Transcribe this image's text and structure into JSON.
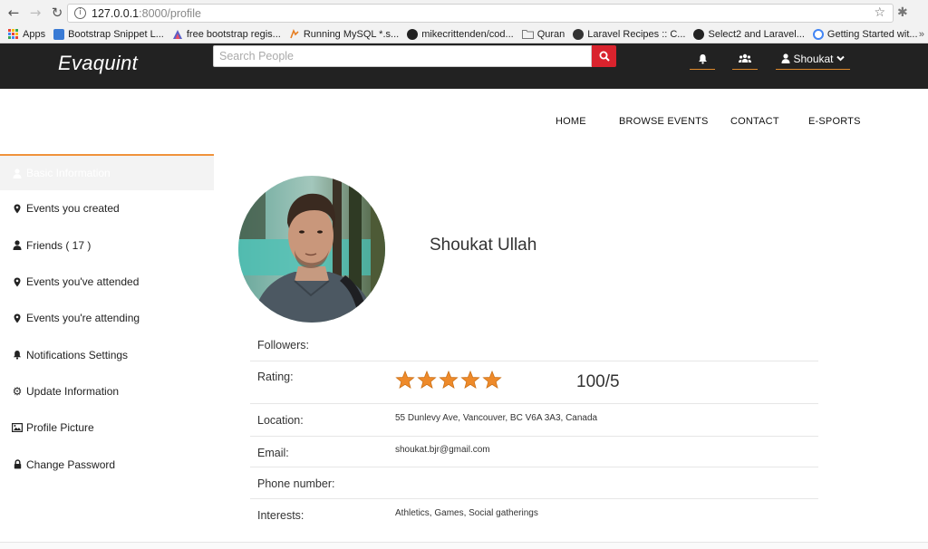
{
  "browser": {
    "url_host": "127.0.0.1",
    "url_path": ":8000/profile",
    "bookmarks": [
      {
        "label": "Apps",
        "icon": "apps-grid-icon",
        "color": ""
      },
      {
        "label": "Bootstrap Snippet L...",
        "icon": "bootstrap-snippet-icon",
        "color": "#3a7bd5"
      },
      {
        "label": "free bootstrap regis...",
        "icon": "triangle-logo-icon",
        "color": "#5b5fc7"
      },
      {
        "label": "Running MySQL *.s...",
        "icon": "mysql-icon",
        "color": "#e67e22"
      },
      {
        "label": "mikecrittenden/cod...",
        "icon": "github-icon",
        "color": "#222222"
      },
      {
        "label": "Quran",
        "icon": "folder-icon",
        "color": "#777777"
      },
      {
        "label": "Laravel Recipes :: C...",
        "icon": "laravel-recipes-icon",
        "color": "#333333"
      },
      {
        "label": "Select2 and Laravel...",
        "icon": "github-icon",
        "color": "#222222"
      },
      {
        "label": "Getting Started wit...",
        "icon": "chrome-icon",
        "color": "#4285f4"
      }
    ]
  },
  "header": {
    "brand": "Evaquint",
    "search_placeholder": "Search People",
    "user_name": "Shoukat",
    "accent_color": "#e08a2c",
    "search_button_color": "#d9232d"
  },
  "nav": {
    "items": [
      "HOME",
      "BROWSE EVENTS",
      "CONTACT",
      "E-SPORTS"
    ]
  },
  "sidebar": {
    "items": [
      {
        "label": "Basic Information",
        "icon": "user-icon",
        "active": true
      },
      {
        "label": "Events you created",
        "icon": "map-marker-icon"
      },
      {
        "label": "Friends ( 17 )",
        "icon": "user-icon"
      },
      {
        "label": "Events you've attended",
        "icon": "map-marker-icon"
      },
      {
        "label": "Events you're attending",
        "icon": "map-marker-icon"
      },
      {
        "label": "Notifications Settings",
        "icon": "bell-icon"
      },
      {
        "label": "Update Information",
        "icon": "gear-icon"
      },
      {
        "label": "Profile Picture",
        "icon": "picture-icon"
      },
      {
        "label": "Change Password",
        "icon": "lock-icon"
      }
    ]
  },
  "profile": {
    "name": "Shoukat Ullah",
    "followers_label": "Followers:",
    "followers_value": "",
    "rating_label": "Rating:",
    "rating_stars": 5,
    "rating_max_stars": 5,
    "rating_text": "100/5",
    "location_label": "Location:",
    "location_value": "55 Dunlevy Ave, Vancouver, BC V6A 3A3, Canada",
    "email_label": "Email:",
    "email_value": "shoukat.bjr@gmail.com",
    "phone_label": "Phone number:",
    "phone_value": "",
    "interests_label": "Interests:",
    "interests_value": "Athletics, Games, Social gatherings",
    "star_color": "#ee8a2a"
  }
}
